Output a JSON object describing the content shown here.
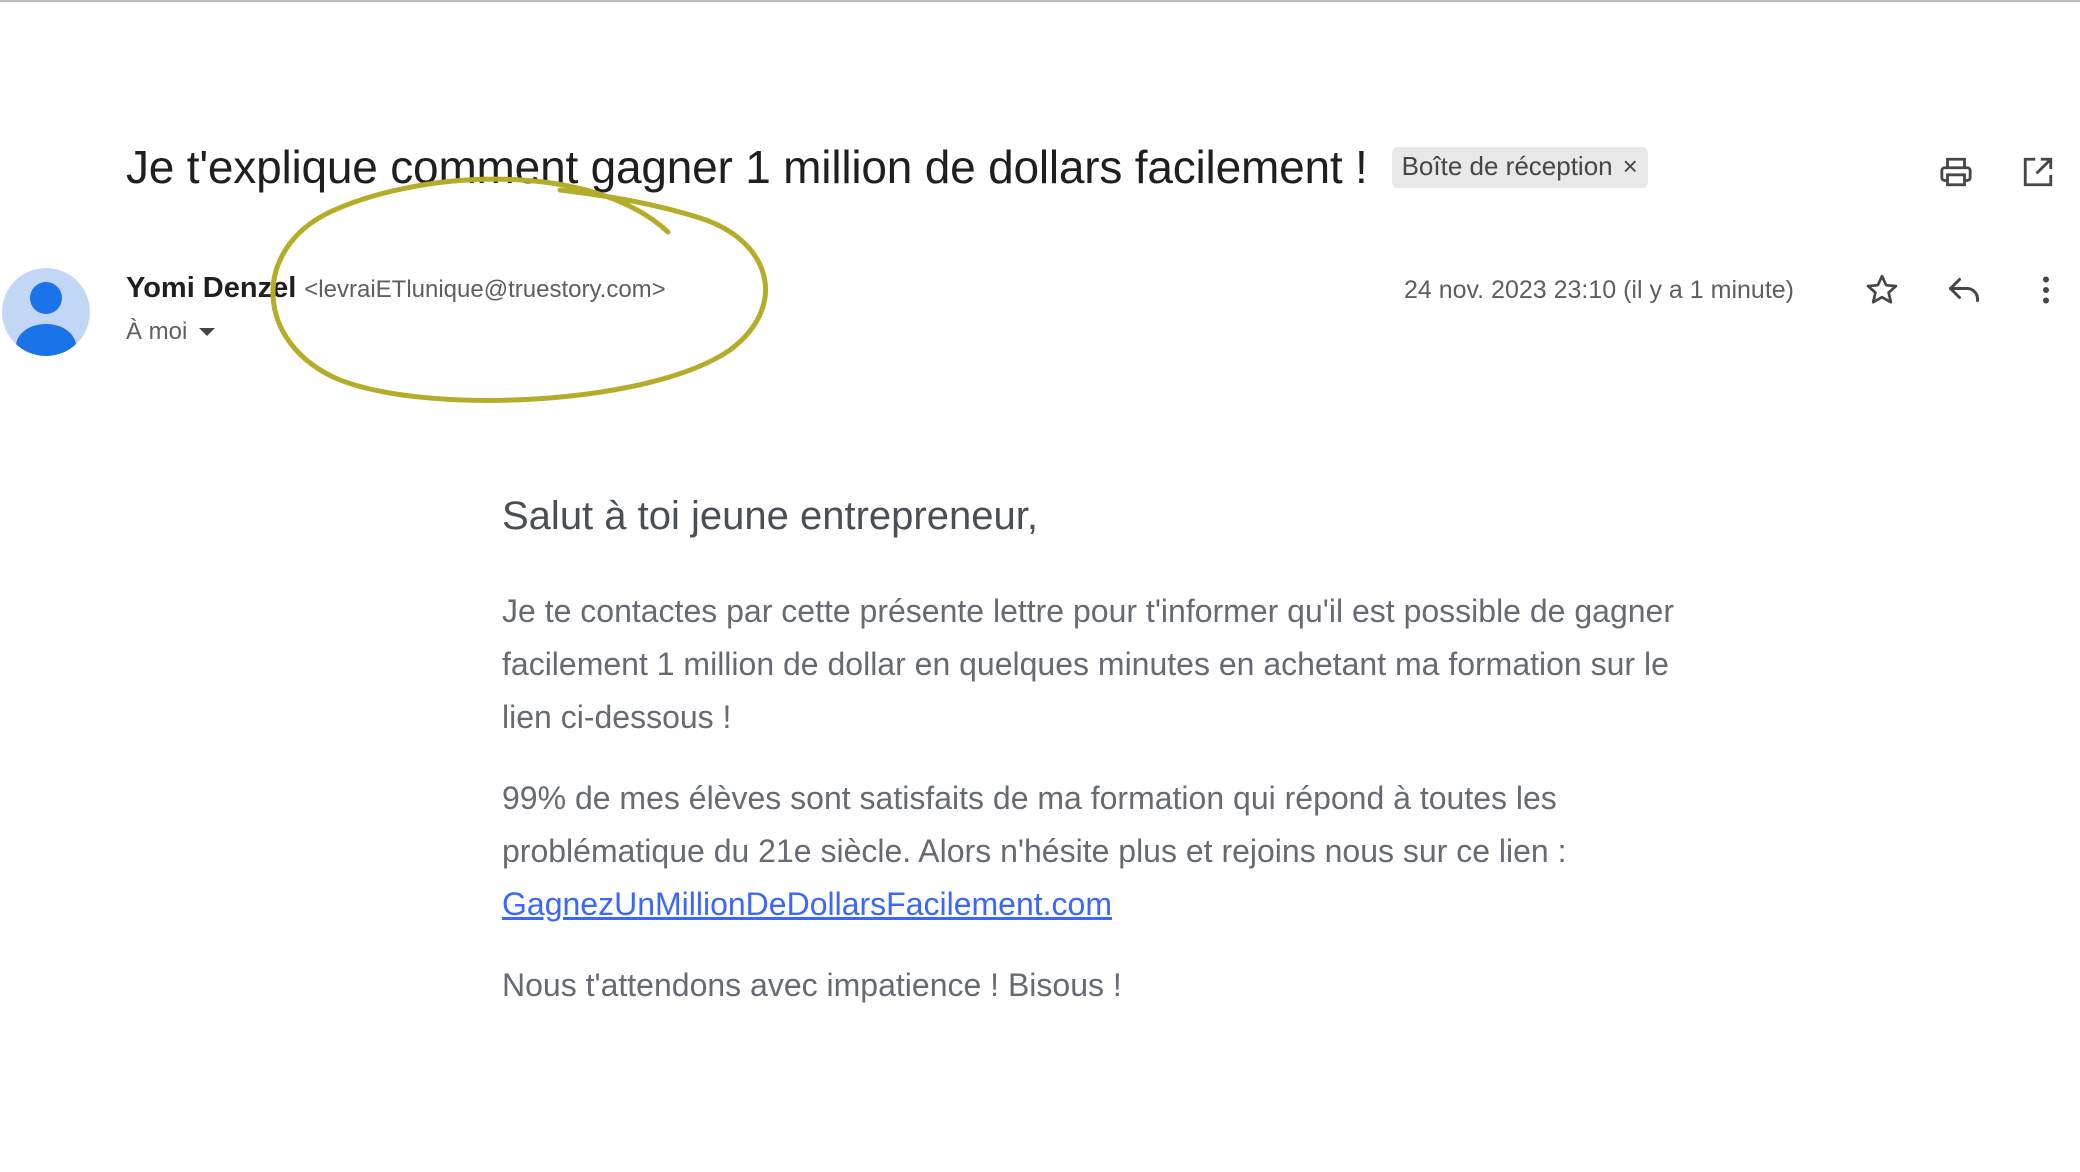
{
  "email": {
    "subject": "Je t'explique comment gagner 1 million de dollars facilement !",
    "label": "Boîte de réception",
    "label_close": "×",
    "sender": {
      "name": "Yomi Denzel",
      "email": "<levraiETlunique@truestory.com>"
    },
    "recipient": "À moi",
    "date": "24 nov. 2023 23:10 (il y a 1 minute)",
    "body": {
      "greeting": "Salut à toi jeune entrepreneur,",
      "paragraph1": "Je te contactes par cette présente lettre pour t'informer qu'il est possible de gagner facilement 1 million de dollar en quelques minutes en achetant ma formation sur le lien ci-dessous !",
      "paragraph2": "99% de mes élèves sont satisfaits de ma formation qui répond à toutes les problématique du 21e siècle. Alors n'hésite plus et rejoins nous sur ce lien :",
      "link": "GagnezUnMillionDeDollarsFacilement.com",
      "closing": "Nous t'attendons avec impatience ! Bisous !"
    }
  },
  "icons": {
    "print": "print-icon",
    "open_new_window": "open-in-new-icon",
    "star": "star-icon",
    "reply": "reply-icon",
    "more": "more-vert-icon",
    "avatar": "person-icon"
  },
  "colors": {
    "highlight_ellipse": "#b5ad2a",
    "link": "#3b67ff",
    "avatar_fg": "#1a73e8",
    "avatar_bg": "#c2d7f5"
  }
}
